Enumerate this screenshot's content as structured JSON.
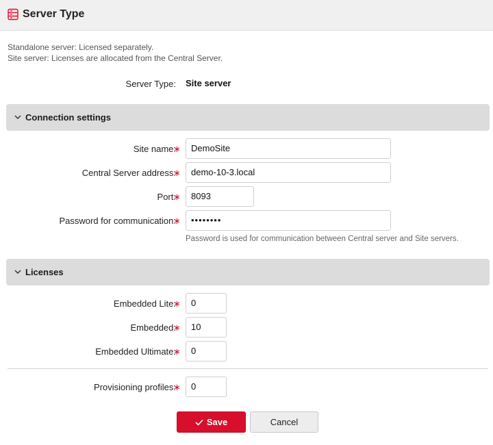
{
  "header": {
    "title": "Server Type",
    "icon": "server-icon"
  },
  "description": {
    "line1": "Standalone server: Licensed separately.",
    "line2": "Site server: Licenses are allocated from the Central Server."
  },
  "server_type": {
    "label": "Server Type:",
    "value": "Site server"
  },
  "connection": {
    "title": "Connection settings",
    "site_name": {
      "label": "Site name:",
      "value": "DemoSite"
    },
    "central_address": {
      "label": "Central Server address:",
      "value": "demo-10-3.local"
    },
    "port": {
      "label": "Port:",
      "value": "8093"
    },
    "password": {
      "label": "Password for communication:",
      "value": "••••••••",
      "hint": "Password is used for communication between Central server and Site servers."
    }
  },
  "licenses": {
    "title": "Licenses",
    "embedded_lite": {
      "label": "Embedded Lite:",
      "value": "0"
    },
    "embedded": {
      "label": "Embedded:",
      "value": "10"
    },
    "embedded_ultimate": {
      "label": "Embedded Ultimate:",
      "value": "0"
    },
    "provisioning": {
      "label": "Provisioning profiles:",
      "value": "0"
    }
  },
  "required_marker": "∗",
  "buttons": {
    "save": "Save",
    "cancel": "Cancel"
  },
  "colors": {
    "accent": "#d70f2d",
    "section_bg": "#dcdcdc",
    "header_bg": "#f0f0f0"
  }
}
